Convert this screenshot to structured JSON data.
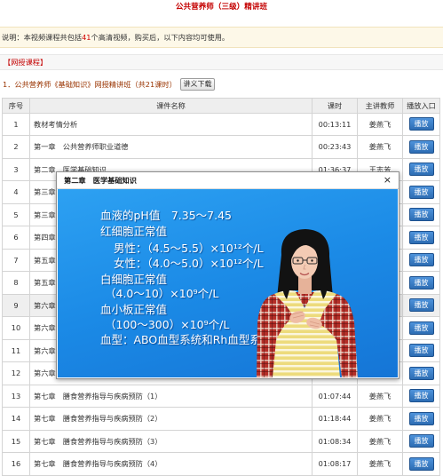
{
  "page": {
    "title": "公共营养师（三级）精讲班"
  },
  "notice": {
    "prefix": "说明：本视频课程共包括",
    "video_count": "41",
    "suffix": "个高清视频，购买后，以下内容均可使用。"
  },
  "section": {
    "label": "【网授课程】"
  },
  "course": {
    "title": "1．公共营养师《基础知识》网授精讲班（共21课时）",
    "download_label": "讲义下载"
  },
  "table": {
    "headers": [
      "序号",
      "课件名称",
      "课时",
      "主讲教师",
      "播放入口"
    ],
    "play_label": "播放",
    "rows": [
      {
        "no": "1",
        "name": "教材考情分析",
        "duration": "00:13:11",
        "teacher": "姜燕飞"
      },
      {
        "no": "2",
        "name": "第一章　公共营养师职业道德",
        "duration": "00:23:43",
        "teacher": "姜燕飞"
      },
      {
        "no": "3",
        "name": "第二章　医学基础知识",
        "duration": "01:36:37",
        "teacher": "王志芳"
      },
      {
        "no": "4",
        "name": "第三章"
      },
      {
        "no": "5",
        "name": "第三章"
      },
      {
        "no": "6",
        "name": "第四章"
      },
      {
        "no": "7",
        "name": "第五章"
      },
      {
        "no": "8",
        "name": "第五章"
      },
      {
        "no": "9",
        "name": "第六章",
        "highlighted": true
      },
      {
        "no": "10",
        "name": "第六章"
      },
      {
        "no": "11",
        "name": "第六章"
      },
      {
        "no": "12",
        "name": "第六章"
      },
      {
        "no": "13",
        "name": "第七章　膳食营养指导与疾病预防（1）",
        "duration": "01:07:44",
        "teacher": "姜燕飞"
      },
      {
        "no": "14",
        "name": "第七章　膳食营养指导与疾病预防（2）",
        "duration": "01:18:44",
        "teacher": "姜燕飞"
      },
      {
        "no": "15",
        "name": "第七章　膳食营养指导与疾病预防（3）",
        "duration": "01:08:34",
        "teacher": "姜燕飞"
      },
      {
        "no": "16",
        "name": "第七章　膳食营养指导与疾病预防（4）",
        "duration": "01:08:17",
        "teacher": "姜燕飞"
      }
    ]
  },
  "video_popup": {
    "title": "第二章　医学基础知识",
    "close_glyph": "×",
    "close_icon": "close-icon",
    "slide_lines": [
      "血液的pH值　7.35～7.45",
      "红细胞正常值",
      "男性：（4.5～5.5）×10¹²个/L",
      "女性：（4.0～5.0）×10¹²个/L",
      "白细胞正常值",
      "（4.0～10）×10⁹个/L",
      "血小板正常值",
      "（100～300）×10⁹个/L",
      "血型：ABO血型系统和Rh血型系统"
    ]
  },
  "colors": {
    "title_red": "#c40000",
    "count_red": "#d00000",
    "course_maroon": "#993300",
    "play_blue": "#2d6db3",
    "video_blue": "#1b8ae6"
  }
}
